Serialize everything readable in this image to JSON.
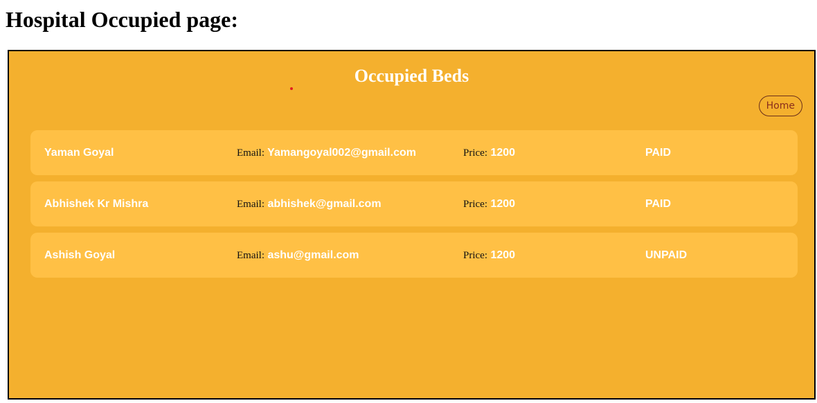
{
  "page": {
    "heading": "Hospital Occupied page:"
  },
  "panel": {
    "title": "Occupied Beds",
    "home_button_label": "Home",
    "background_color": "#f4b02e",
    "row_color": "#ffc045"
  },
  "labels": {
    "email": "Email:",
    "price": "Price:"
  },
  "beds": [
    {
      "name": "Yaman Goyal",
      "email": "Yamangoyal002@gmail.com",
      "price": "1200",
      "status": "PAID"
    },
    {
      "name": "Abhishek Kr Mishra",
      "email": "abhishek@gmail.com",
      "price": "1200",
      "status": "PAID"
    },
    {
      "name": "Ashish Goyal",
      "email": "ashu@gmail.com",
      "price": "1200",
      "status": "UNPAID"
    }
  ]
}
